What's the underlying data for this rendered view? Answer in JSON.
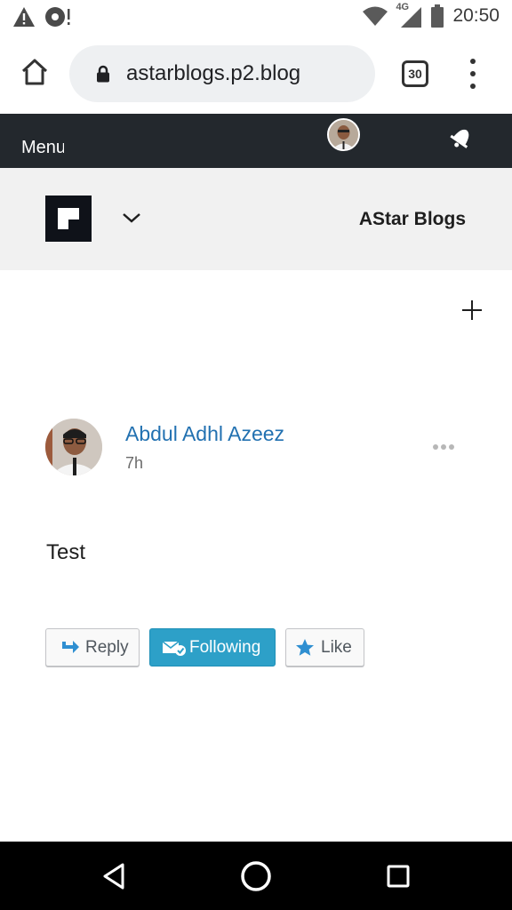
{
  "status_bar": {
    "left_icons": [
      "warning-icon",
      "circle-notification-icon"
    ],
    "network": "4G",
    "time": "20:50"
  },
  "browser": {
    "url": "astarblogs.p2.blog",
    "tab_count": "30"
  },
  "masterbar": {
    "menu_label": "Menu"
  },
  "site": {
    "title": "AStar Blogs"
  },
  "post": {
    "author": "Abdul Adhl Azeez",
    "time": "7h",
    "body": "Test",
    "actions": {
      "reply_label": "Reply",
      "following_label": "Following",
      "like_label": "Like"
    }
  },
  "colors": {
    "masterbar_bg": "#23282d",
    "link_blue": "#2271b1",
    "following_bg": "#2da0c8",
    "site_header_bg": "#f1f1f1"
  }
}
